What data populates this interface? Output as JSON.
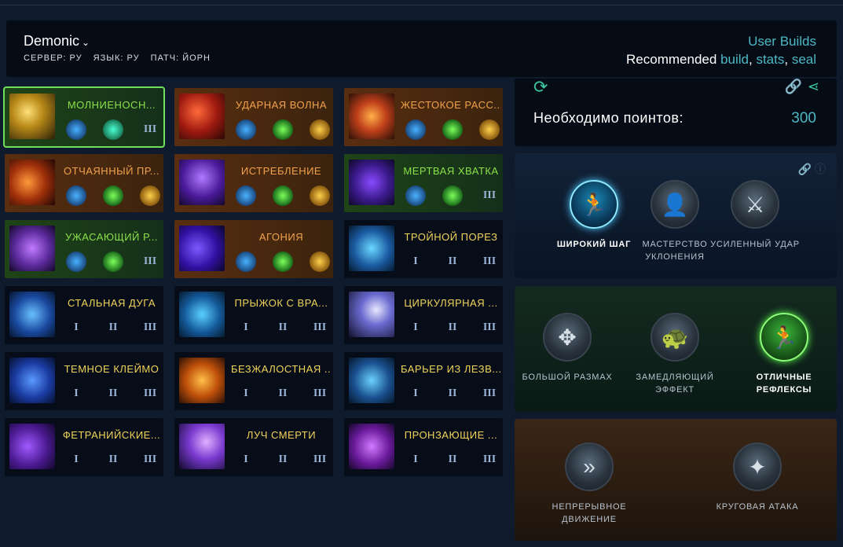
{
  "header": {
    "build_name": "Demonic",
    "server_label": "СЕРВЕР: РУ",
    "language_label": "ЯЗЫК: РУ",
    "patch_label": "ПАТЧ: ЙОРН",
    "user_builds": "User Builds",
    "recommended_prefix": "Recommended",
    "link_build": "build",
    "sep1": ",",
    "link_stats": "stats",
    "sep2": ",",
    "link_seal": "seal"
  },
  "skills": [
    {
      "title": "МОЛНИЕНОСН...",
      "style": "green",
      "icon": "lightning-icon",
      "slots": [
        "blue-gem",
        "teal-gem",
        "III"
      ]
    },
    {
      "title": "УДАРНАЯ ВОЛНА",
      "style": "orange",
      "icon": "shockwave-icon",
      "slots": [
        "blue-gem",
        "green-gem",
        "gold-gem"
      ]
    },
    {
      "title": "ЖЕСТОКОЕ РАСС...",
      "style": "orange",
      "icon": "slash-icon",
      "slots": [
        "blue-gem",
        "green-gem",
        "gold-gem"
      ]
    },
    {
      "title": "ОТЧАЯННЫЙ ПР...",
      "style": "orange",
      "icon": "fire-spin-icon",
      "slots": [
        "blue-gem",
        "green-gem",
        "gold-gem"
      ]
    },
    {
      "title": "ИСТРЕБЛЕНИЕ",
      "style": "orange",
      "icon": "bat-icon",
      "slots": [
        "blue-gem",
        "green-gem",
        "gold-gem"
      ]
    },
    {
      "title": "МЕРТВАЯ ХВАТКА",
      "style": "green",
      "icon": "claw-icon",
      "slots": [
        "blue-gem",
        "green-gem",
        "III"
      ]
    },
    {
      "title": "УЖАСАЮЩИЙ Р...",
      "style": "green",
      "icon": "demon-icon",
      "slots": [
        "blue-gem",
        "green-gem",
        "III"
      ]
    },
    {
      "title": "АГОНИЯ",
      "style": "orange",
      "icon": "claw-strike-icon",
      "slots": [
        "blue-gem",
        "green-gem",
        "gold-gem"
      ]
    },
    {
      "title": "ТРОЙНОЙ ПОРЕЗ",
      "style": "plain",
      "icon": "triple-slash-icon",
      "slots": [
        "I",
        "II",
        "III"
      ]
    },
    {
      "title": "СТАЛЬНАЯ ДУГА",
      "style": "plain",
      "icon": "steel-arc-icon",
      "slots": [
        "I",
        "II",
        "III"
      ]
    },
    {
      "title": "ПРЫЖОК С ВРА...",
      "style": "plain",
      "icon": "whirl-icon",
      "slots": [
        "I",
        "II",
        "III"
      ]
    },
    {
      "title": "ЦИРКУЛЯРНАЯ ...",
      "style": "plain",
      "icon": "circular-icon",
      "slots": [
        "I",
        "II",
        "III"
      ]
    },
    {
      "title": "ТЕМНОЕ КЛЕЙМО",
      "style": "plain",
      "icon": "dark-mark-icon",
      "slots": [
        "I",
        "II",
        "III"
      ]
    },
    {
      "title": "БЕЗЖАЛОСТНАЯ ...",
      "style": "plain",
      "icon": "ruthless-icon",
      "slots": [
        "I",
        "II",
        "III"
      ]
    },
    {
      "title": "БАРЬЕР ИЗ ЛЕЗВ...",
      "style": "plain",
      "icon": "blade-barrier-icon",
      "slots": [
        "I",
        "II",
        "III"
      ]
    },
    {
      "title": "ФЕТРАНИЙСКИЕ...",
      "style": "plain",
      "icon": "fetranian-icon",
      "slots": [
        "I",
        "II",
        "III"
      ]
    },
    {
      "title": "ЛУЧ СМЕРТИ",
      "style": "plain",
      "icon": "death-ray-icon",
      "slots": [
        "I",
        "II",
        "III"
      ]
    },
    {
      "title": "ПРОНЗАЮЩИЕ ...",
      "style": "plain",
      "icon": "piercing-icon",
      "slots": [
        "I",
        "II",
        "III"
      ]
    }
  ],
  "points": {
    "label": "Необходимо поинтов:",
    "value": "300"
  },
  "tier1": [
    {
      "label": "ШИРОКИЙ ШАГ",
      "state": "active-blue",
      "icon": "running-icon"
    },
    {
      "label": "МАСТЕРСТВО УКЛОНЕНИЯ",
      "state": "off",
      "icon": "dodge-icon"
    },
    {
      "label": "УСИЛЕННЫЙ УДАР",
      "state": "off",
      "icon": "sword-strike-icon"
    }
  ],
  "tier2": [
    {
      "label": "БОЛЬШОЙ РАЗМАХ",
      "state": "off",
      "icon": "expand-arrows-icon"
    },
    {
      "label": "ЗАМЕДЛЯЮЩИЙ ЭФФЕКТ",
      "state": "off",
      "icon": "turtle-icon"
    },
    {
      "label": "ОТЛИЧНЫЕ РЕФЛЕКСЫ",
      "state": "active-green",
      "icon": "sprint-icon"
    }
  ],
  "tier3": [
    {
      "label": "НЕПРЕРЫВНОЕ ДВИЖЕНИЕ",
      "state": "off",
      "icon": "chevrons-icon"
    },
    {
      "label": "КРУГОВАЯ АТАКА",
      "state": "off",
      "icon": "circle-attack-icon"
    }
  ],
  "colors": {
    "accent_link": "#4db8c4",
    "orange_title": "#f1a24a",
    "green_title": "#8be04a",
    "plain_title": "#f2d35a",
    "teal_icon": "#3bc8a0"
  }
}
